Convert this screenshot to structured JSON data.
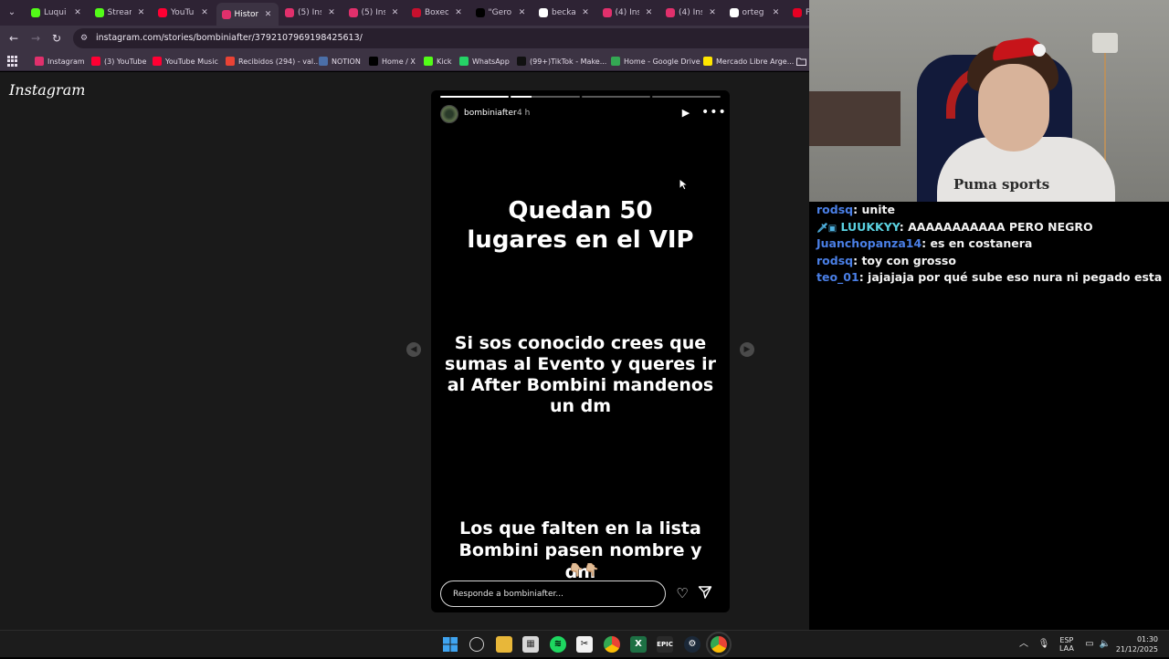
{
  "browser": {
    "tabs": [
      {
        "label": "Luqui",
        "color": "#53fc18"
      },
      {
        "label": "Stream",
        "color": "#53fc18"
      },
      {
        "label": "YouTu",
        "color": "#ff0033"
      },
      {
        "label": "Histor",
        "color": "#e1306c"
      },
      {
        "label": "(5) Ins",
        "color": "#e1306c"
      },
      {
        "label": "(5) Ins",
        "color": "#e1306c"
      },
      {
        "label": "Boxeo",
        "color": "#c8102e"
      },
      {
        "label": "\"Gero",
        "color": "#000000"
      },
      {
        "label": "becka",
        "color": "#ffffff"
      },
      {
        "label": "(4) Ins",
        "color": "#e1306c"
      },
      {
        "label": "(4) Ins",
        "color": "#e1306c"
      },
      {
        "label": "orteg",
        "color": "#ffffff"
      },
      {
        "label": "Pi",
        "color": "#e60023"
      }
    ],
    "tab_close_glyph": "✕",
    "url": "instagram.com/stories/bombiniafter/3792107969198425613/",
    "bookmarks": [
      {
        "label": "Instagram",
        "color": "#e1306c"
      },
      {
        "label": "(3) YouTube",
        "color": "#ff0033"
      },
      {
        "label": "YouTube Music",
        "color": "#ff0033"
      },
      {
        "label": "Recibidos (294) - val...",
        "color": "#ea4335"
      },
      {
        "label": "NOTION",
        "color": "#4b6fa8"
      },
      {
        "label": "Home / X",
        "color": "#000000"
      },
      {
        "label": "Kick",
        "color": "#53fc18"
      },
      {
        "label": "WhatsApp",
        "color": "#25d366"
      },
      {
        "label": "(99+)TikTok - Make...",
        "color": "#111111"
      },
      {
        "label": "Home - Google Drive",
        "color": "#34a853"
      },
      {
        "label": "Mercado Libre Arge...",
        "color": "#ffe600"
      }
    ]
  },
  "instagram": {
    "logo": "Instagram",
    "story": {
      "username": "bombiniafter",
      "time": "4 h",
      "progress_segments": 4,
      "current_segment": 2,
      "text_1": "Quedan 50 lugares en el VIP",
      "text_2": "Si sos conocido crees que sumas al Evento y queres ir al After Bombini mandenos un dm",
      "text_3": "Los que falten en la lista Bombini pasen nombre y dni",
      "emoji": "👇🏼👇🏼",
      "reply_placeholder": "Responde a bombiniafter..."
    }
  },
  "chat": [
    {
      "user": "rodsq",
      "badges": "",
      "message": "unite",
      "user_color": "#4a7fe6"
    },
    {
      "user": "LUUKKYY",
      "badges": "🗡▣",
      "message": "AAAAAAAAAAA PERO NEGRO",
      "user_color": "#5ad1e0"
    },
    {
      "user": "Juanchopanza14",
      "badges": "",
      "message": "es en costanera",
      "user_color": "#4a7fe6"
    },
    {
      "user": "rodsq",
      "badges": "",
      "message": "toy con grosso",
      "user_color": "#4a7fe6"
    },
    {
      "user": "teo_01",
      "badges": "",
      "message": "jajajaja por qué sube eso nura ni pegado esta",
      "user_color": "#4a7fe6"
    }
  ],
  "webcam": {
    "shirt_text": "Puma sports"
  },
  "taskbar": {
    "lang_line1": "ESP",
    "lang_line2": "LAA",
    "time": "01:30",
    "date": "21/12/2025"
  }
}
